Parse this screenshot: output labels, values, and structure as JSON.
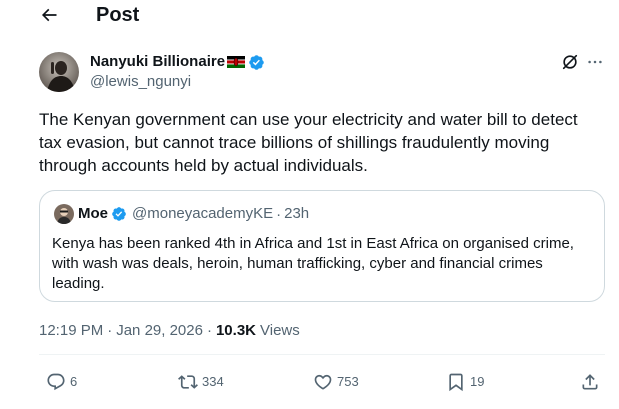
{
  "header": {
    "title": "Post",
    "back_icon": "arrow-left-icon"
  },
  "post": {
    "author": {
      "name": "Nanyuki Billionaire",
      "flag_icon": "kenya-flag-icon",
      "verified_icon": "verified-badge-icon",
      "handle": "@lewis_ngunyi"
    },
    "grok_icon": "grok-icon",
    "more_icon": "more-horizontal-icon",
    "text_lines": [
      "The Kenyan government can use your electricity and water bill to detect",
      "tax evasion, but cannot trace billions of shillings fraudulently moving",
      "through accounts held by actual individuals."
    ],
    "quote": {
      "name": "Moe",
      "handle": "@moneyacademyKE",
      "dot": "·",
      "time": "23h",
      "text_lines": [
        "Kenya has been ranked 4th in Africa and 1st in East Africa on organised crime,",
        "with wash was deals, heroin, human trafficking, cyber and financial crimes",
        "leading."
      ]
    },
    "meta": {
      "time": "12:19 PM",
      "sep1": "·",
      "date": "Jan 29, 2026",
      "sep2": "·",
      "views_count": "10.3K",
      "views_label": "Views"
    },
    "actions": {
      "replies": "6",
      "reposts": "334",
      "likes": "753",
      "bookmarks": "19"
    }
  },
  "colors": {
    "text": "#0f1419",
    "secondary": "#536471",
    "verified": "#1d9bf0",
    "border": "#cfd9de"
  }
}
